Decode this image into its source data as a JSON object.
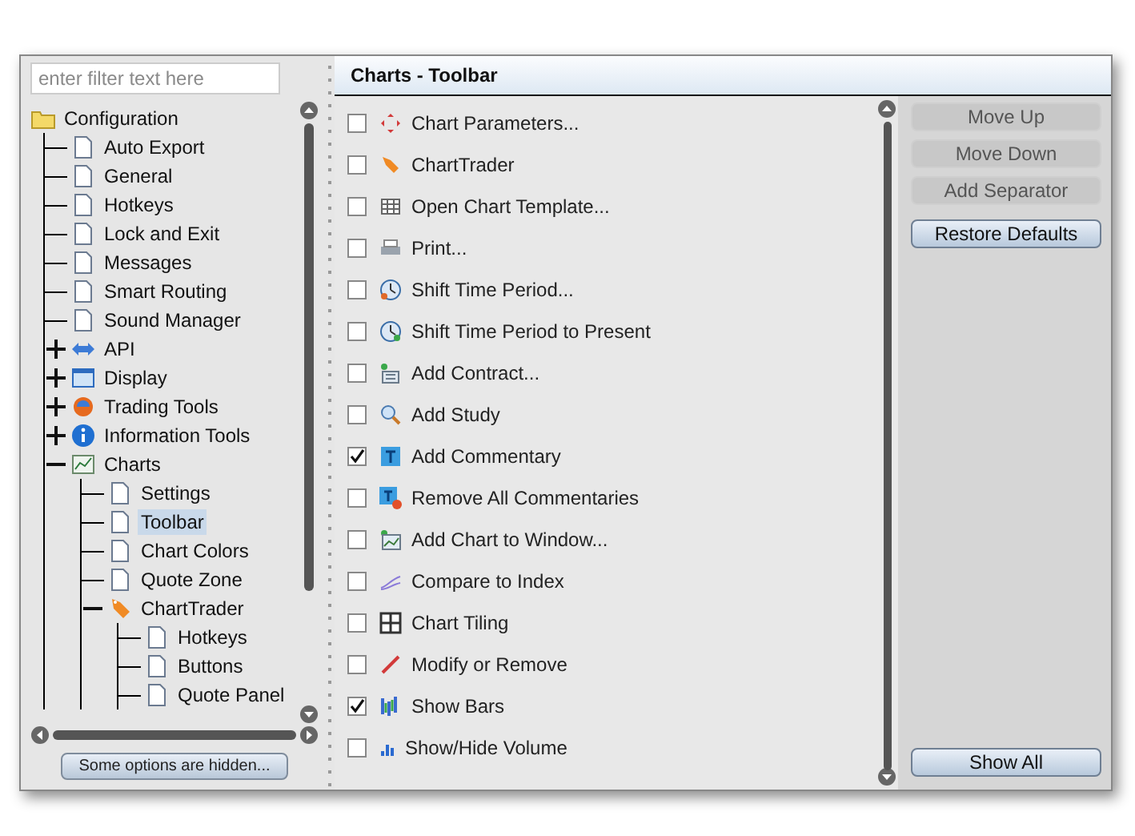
{
  "filter": {
    "placeholder": "enter filter text here"
  },
  "tree": [
    {
      "label": "Configuration",
      "kind": "folder",
      "selected": false,
      "children": [
        {
          "label": "Auto Export",
          "kind": "page",
          "selected": false
        },
        {
          "label": "General",
          "kind": "page",
          "selected": false
        },
        {
          "label": "Hotkeys",
          "kind": "page",
          "selected": false
        },
        {
          "label": "Lock and Exit",
          "kind": "page",
          "selected": false
        },
        {
          "label": "Messages",
          "kind": "page",
          "selected": false
        },
        {
          "label": "Smart Routing",
          "kind": "page",
          "selected": false
        },
        {
          "label": "Sound Manager",
          "kind": "page",
          "selected": false
        },
        {
          "label": "API",
          "kind": "api",
          "expanded": false,
          "selected": false
        },
        {
          "label": "Display",
          "kind": "display",
          "expanded": false,
          "selected": false
        },
        {
          "label": "Trading Tools",
          "kind": "tools",
          "expanded": false,
          "selected": false
        },
        {
          "label": "Information Tools",
          "kind": "info",
          "expanded": false,
          "selected": false
        },
        {
          "label": "Charts",
          "kind": "chart",
          "expanded": true,
          "selected": false,
          "children": [
            {
              "label": "Settings",
              "kind": "page",
              "selected": false
            },
            {
              "label": "Toolbar",
              "kind": "page",
              "selected": true
            },
            {
              "label": "Chart Colors",
              "kind": "page",
              "selected": false
            },
            {
              "label": "Quote Zone",
              "kind": "page",
              "selected": false
            },
            {
              "label": "ChartTrader",
              "kind": "trader",
              "expanded": true,
              "selected": false,
              "children": [
                {
                  "label": "Hotkeys",
                  "kind": "page",
                  "selected": false
                },
                {
                  "label": "Buttons",
                  "kind": "page",
                  "selected": false
                },
                {
                  "label": "Quote Panel",
                  "kind": "page",
                  "selected": false
                }
              ]
            }
          ]
        }
      ]
    }
  ],
  "hidden_button": "Some options are hidden...",
  "panel_title": "Charts - Toolbar",
  "items": [
    {
      "label": "Chart Parameters...",
      "kind": "params",
      "checked": false
    },
    {
      "label": "ChartTrader",
      "kind": "trader",
      "checked": false
    },
    {
      "label": "Open Chart Template...",
      "kind": "grid",
      "checked": false
    },
    {
      "label": "Print...",
      "kind": "print",
      "checked": false
    },
    {
      "label": "Shift Time Period...",
      "kind": "clock",
      "checked": false
    },
    {
      "label": "Shift Time Period to Present",
      "kind": "clock2",
      "checked": false
    },
    {
      "label": "Add Contract...",
      "kind": "contract",
      "checked": false
    },
    {
      "label": "Add Study",
      "kind": "study",
      "checked": false
    },
    {
      "label": "Add Commentary",
      "kind": "text",
      "checked": true
    },
    {
      "label": "Remove All Commentaries",
      "kind": "textremove",
      "checked": false
    },
    {
      "label": "Add Chart to Window...",
      "kind": "addchart",
      "checked": false
    },
    {
      "label": "Compare to Index",
      "kind": "compare",
      "checked": false
    },
    {
      "label": "Chart Tiling",
      "kind": "tiles",
      "checked": false
    },
    {
      "label": "Modify or Remove",
      "kind": "pen",
      "checked": false
    },
    {
      "label": "Show Bars",
      "kind": "bars",
      "checked": true
    },
    {
      "label": "Show/Hide Volume",
      "kind": "volume",
      "checked": false
    }
  ],
  "buttons": [
    {
      "label": "Move Up",
      "disabled": true
    },
    {
      "label": "Move Down",
      "disabled": true
    },
    {
      "label": "Add Separator",
      "disabled": true
    },
    {
      "label": "Restore Defaults",
      "disabled": false
    }
  ],
  "bottom_button": {
    "label": "Show All",
    "disabled": false
  }
}
